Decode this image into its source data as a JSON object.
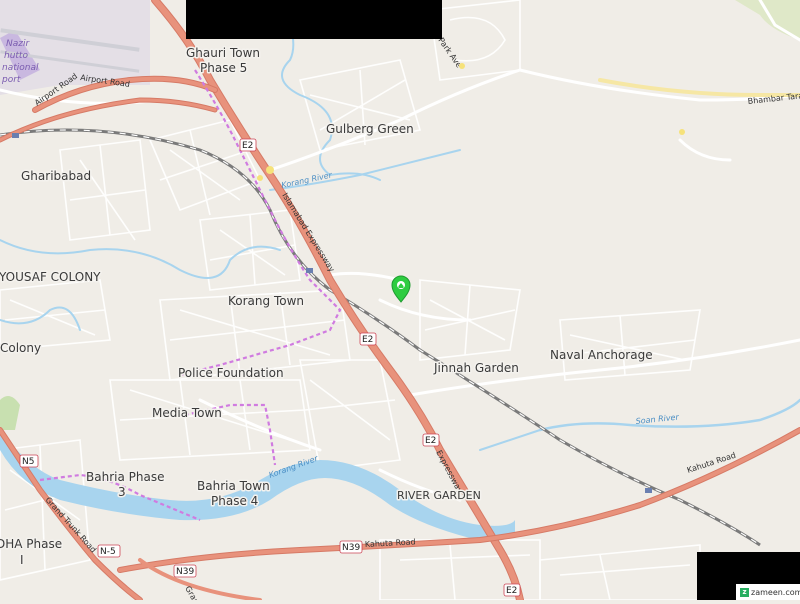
{
  "map": {
    "places": {
      "ghauri_town": "Ghauri Town",
      "phase_5": "Phase 5",
      "gulberg_green": "Gulberg Green",
      "gharibabad": "Gharibabad",
      "yousaf_colony": "YOUSAF COLONY",
      "korang_town": "Korang Town",
      "colony": "Colony",
      "police_foundation": "Police Foundation",
      "media_town": "Media Town",
      "jinnah_garden": "Jinnah Garden",
      "naval_anchorage": "Naval Anchorage",
      "bahria_phase": "Bahria Phase",
      "bahria_phase_num": "3",
      "bahria_town": "Bahria Town",
      "bahria_town_phase": "Phase 4",
      "river_garden": "RIVER GARDEN",
      "dha_phase": "DHA Phase",
      "dha_phase_num": "I",
      "airport_partial": "Nazir\nhutto\nnational\nport"
    },
    "roads": {
      "airport_road_1": "Airport Road",
      "airport_road_2": "Airport Road",
      "islamabad_expressway": "Islamabad Expressway",
      "expressway_lower": "Expressway",
      "kahuta_road_1": "Kahuta Road",
      "kahuta_road_2": "Kahuta Road",
      "bhambar_tarar": "Bhambar Tarar",
      "grand_trunk": "Grand Trunk Road",
      "park_ave": "Park Ave",
      "grand": "Grand"
    },
    "rivers": {
      "korang_river_1": "Korang River",
      "korang_river_2": "Korang River",
      "soan_river": "Soan River"
    },
    "shields": {
      "e2_a": "E2",
      "e2_b": "E2",
      "e2_c": "E2",
      "e2_d": "E2",
      "n5_a": "N5",
      "n5_b": "N-5",
      "n39_a": "N39",
      "n39_b": "N39"
    },
    "watermark": "zameen.com",
    "colors": {
      "background": "#f0ede7",
      "highway": "#e8927c",
      "highway_outline": "#d67a66",
      "river": "#a8d4ee",
      "railway": "#7a7a7a",
      "boundary": "#d07be0",
      "road_minor": "#ffffff",
      "marker": "#2ecc40"
    },
    "marker_icon": "map-pin-icon"
  }
}
